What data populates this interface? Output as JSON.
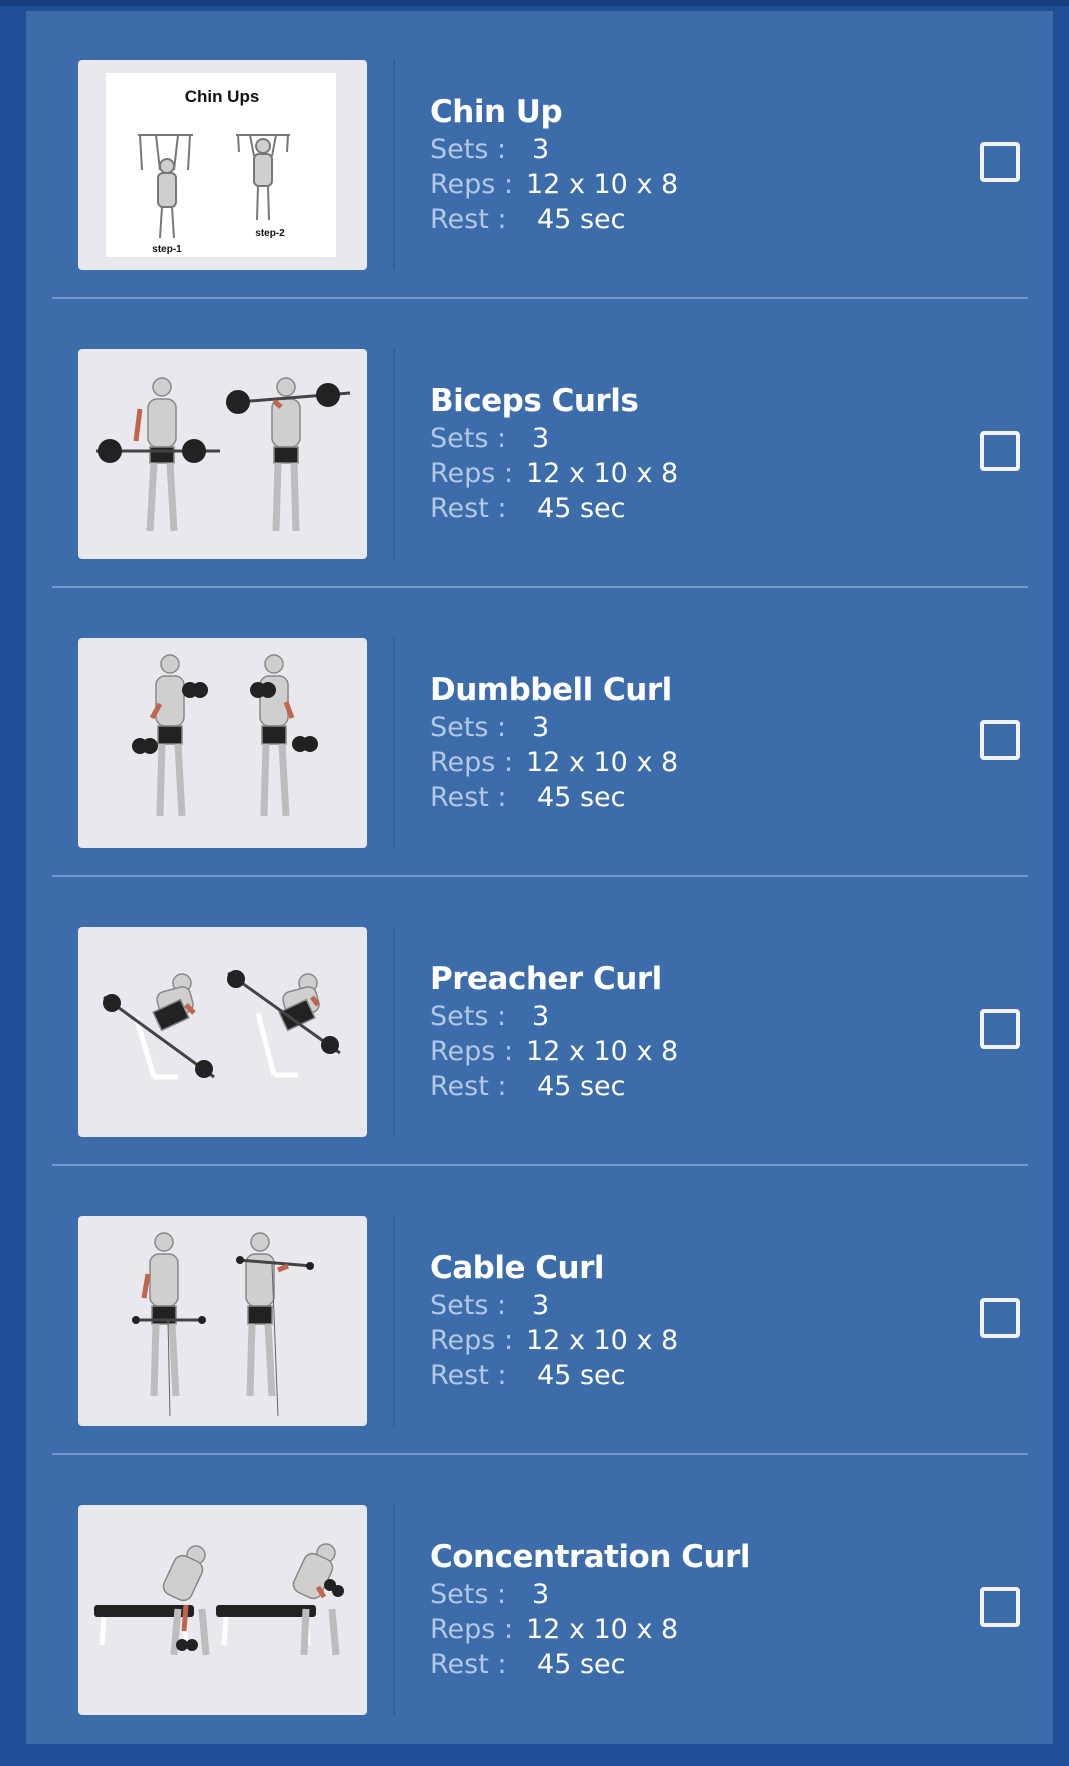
{
  "labels": {
    "sets": "Sets :",
    "reps": "Reps :",
    "rest": "Rest :"
  },
  "exercises": [
    {
      "name": "Chin Up",
      "sets": "3",
      "reps": "12 x 10 x 8",
      "rest": "45 sec",
      "image": {
        "title": "Chin Ups",
        "step1": "step-1",
        "step2": "step-2"
      },
      "checked": false
    },
    {
      "name": "Biceps Curls",
      "sets": "3",
      "reps": "12 x 10 x 8",
      "rest": "45 sec",
      "checked": false
    },
    {
      "name": "Dumbbell Curl",
      "sets": "3",
      "reps": "12 x 10 x 8",
      "rest": "45 sec",
      "checked": false
    },
    {
      "name": "Preacher Curl",
      "sets": "3",
      "reps": "12 x 10 x 8",
      "rest": "45 sec",
      "checked": false
    },
    {
      "name": "Cable Curl",
      "sets": "3",
      "reps": "12 x 10 x 8",
      "rest": "45 sec",
      "checked": false
    },
    {
      "name": "Concentration Curl",
      "sets": "3",
      "reps": "12 x 10 x 8",
      "rest": "45 sec",
      "checked": false
    }
  ],
  "colors": {
    "background": "#1e4f97",
    "card": "#3d6cab",
    "divider": "#7497c6",
    "label": "#b3c7e6",
    "value": "#ffffff"
  }
}
